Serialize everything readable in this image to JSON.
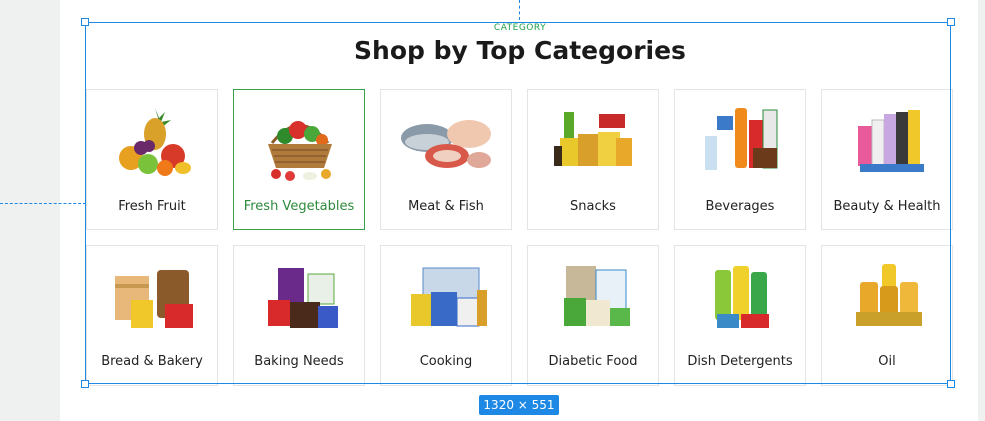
{
  "section": {
    "eyebrow": "CATEGORY",
    "title": "Shop by Top Categories"
  },
  "categories": [
    {
      "label": "Fresh Fruit",
      "icon": "fruit-basket-icon"
    },
    {
      "label": "Fresh Vegetables",
      "icon": "vegetable-basket-icon"
    },
    {
      "label": "Meat & Fish",
      "icon": "meat-fish-icon"
    },
    {
      "label": "Snacks",
      "icon": "snacks-icon"
    },
    {
      "label": "Beverages",
      "icon": "beverages-icon"
    },
    {
      "label": "Beauty & Health",
      "icon": "beauty-health-icon"
    },
    {
      "label": "Bread & Bakery",
      "icon": "bread-bakery-icon"
    },
    {
      "label": "Baking Needs",
      "icon": "baking-needs-icon"
    },
    {
      "label": "Cooking",
      "icon": "cooking-icon"
    },
    {
      "label": "Diabetic Food",
      "icon": "diabetic-food-icon"
    },
    {
      "label": "Dish Detergents",
      "icon": "dish-detergents-icon"
    },
    {
      "label": "Oil",
      "icon": "oil-icon"
    }
  ],
  "selection": {
    "size_label": "1320 × 551",
    "active_category": "Fresh Vegetables"
  },
  "colors": {
    "accent_green": "#3aa04a",
    "selection_blue": "#1e88e5"
  }
}
